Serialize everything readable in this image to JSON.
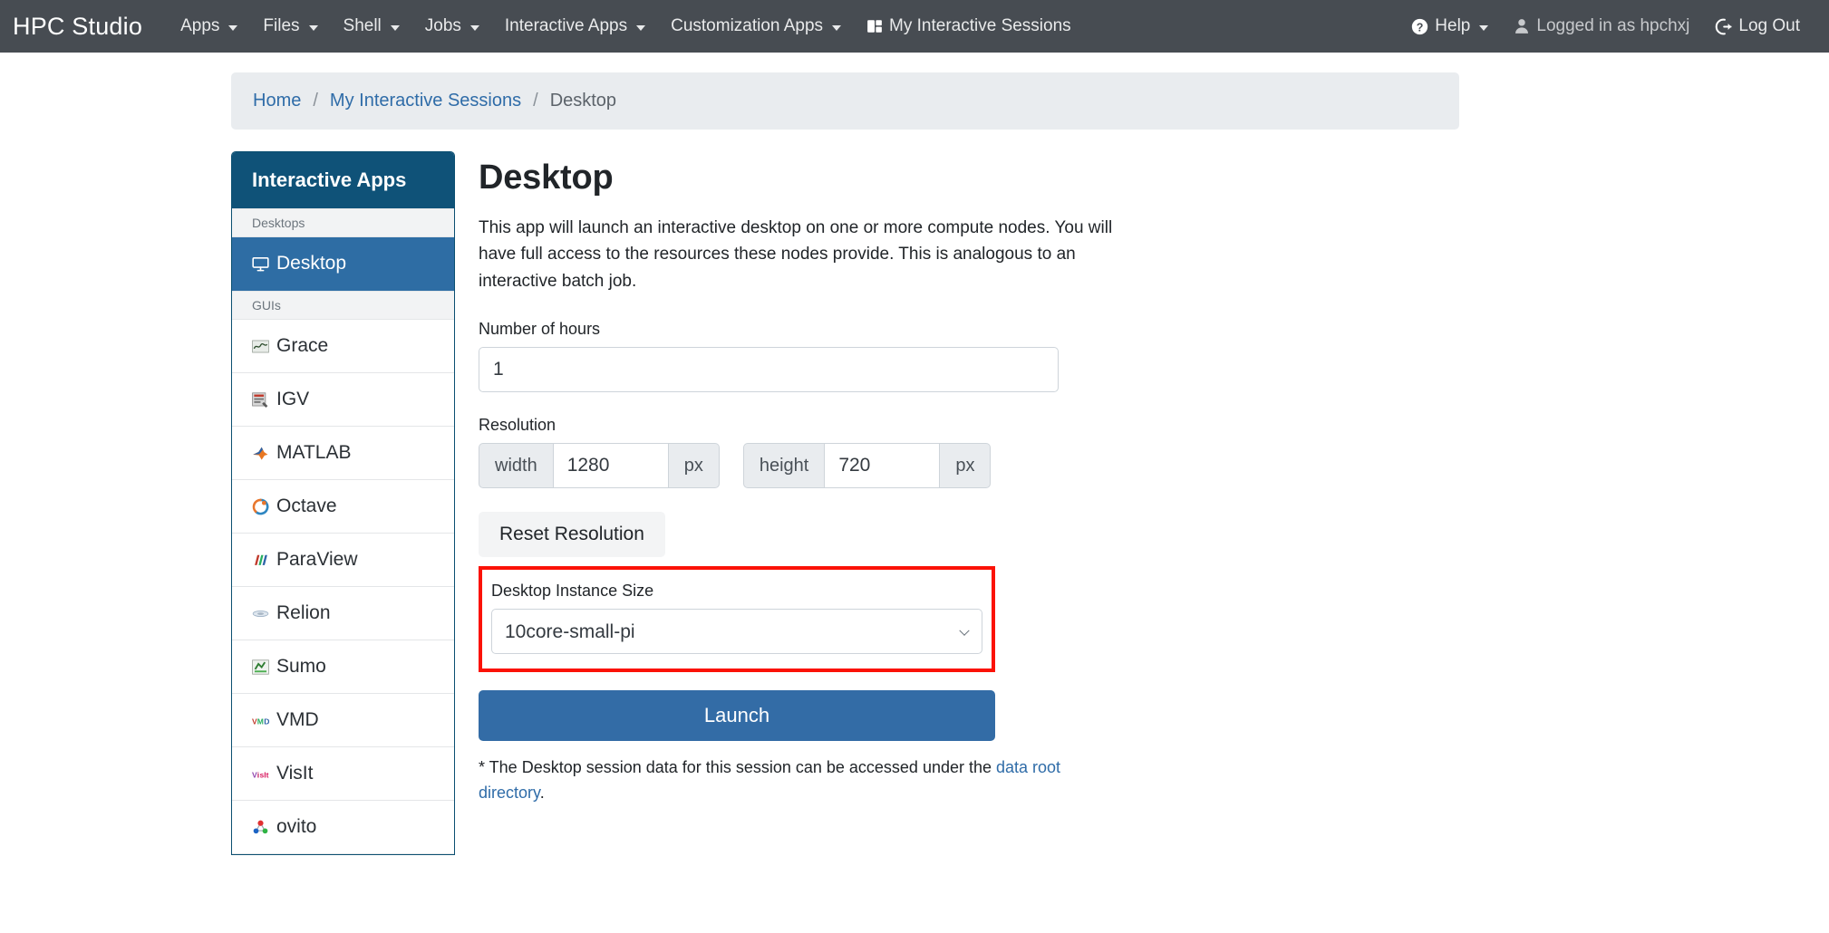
{
  "navbar": {
    "brand": "HPC Studio",
    "items": [
      {
        "label": "Apps",
        "caret": true,
        "icon": null
      },
      {
        "label": "Files",
        "caret": true,
        "icon": null
      },
      {
        "label": "Shell",
        "caret": true,
        "icon": null
      },
      {
        "label": "Jobs",
        "caret": true,
        "icon": null
      },
      {
        "label": "Interactive Apps",
        "caret": true,
        "icon": null
      },
      {
        "label": "Customization Apps",
        "caret": true,
        "icon": null
      },
      {
        "label": "My Interactive Sessions",
        "caret": false,
        "icon": "windows-stack-icon"
      }
    ],
    "right": [
      {
        "label": "Help",
        "caret": true,
        "icon": "question-circle-icon"
      },
      {
        "label": "Logged in as hpchxj",
        "caret": false,
        "icon": "user-icon"
      },
      {
        "label": "Log Out",
        "caret": false,
        "icon": "logout-icon"
      }
    ]
  },
  "breadcrumb": {
    "home": "Home",
    "sessions": "My Interactive Sessions",
    "current": "Desktop",
    "separator": "/"
  },
  "sidebar": {
    "header": "Interactive Apps",
    "groups": [
      {
        "label": "Desktops",
        "items": [
          {
            "label": "Desktop",
            "icon": "monitor-icon",
            "active": true
          }
        ]
      },
      {
        "label": "GUIs",
        "items": [
          {
            "label": "Grace",
            "icon": "grace-icon",
            "active": false
          },
          {
            "label": "IGV",
            "icon": "igv-icon",
            "active": false
          },
          {
            "label": "MATLAB",
            "icon": "matlab-icon",
            "active": false
          },
          {
            "label": "Octave",
            "icon": "octave-icon",
            "active": false
          },
          {
            "label": "ParaView",
            "icon": "paraview-icon",
            "active": false
          },
          {
            "label": "Relion",
            "icon": "relion-icon",
            "active": false
          },
          {
            "label": "Sumo",
            "icon": "sumo-icon",
            "active": false
          },
          {
            "label": "VMD",
            "icon": "vmd-icon",
            "active": false
          },
          {
            "label": "VisIt",
            "icon": "visit-icon",
            "active": false
          },
          {
            "label": "ovito",
            "icon": "ovito-icon",
            "active": false
          }
        ]
      }
    ]
  },
  "main": {
    "title": "Desktop",
    "description": "This app will launch an interactive desktop on one or more compute nodes. You will have full access to the resources these nodes provide. This is analogous to an interactive batch job.",
    "hours": {
      "label": "Number of hours",
      "value": "1"
    },
    "resolution": {
      "label": "Resolution",
      "width": {
        "addon": "width",
        "value": "1280",
        "unit": "px"
      },
      "height": {
        "addon": "height",
        "value": "720",
        "unit": "px"
      }
    },
    "reset_button": "Reset Resolution",
    "instance_size": {
      "label": "Desktop Instance Size",
      "selected": "10core-small-pi",
      "options": [
        "10core-small-pi"
      ],
      "highlight_color": "#fb1207"
    },
    "launch_button": "Launch",
    "footnote": {
      "prefix": "* The Desktop session data for this session can be accessed under the ",
      "link": "data root directory",
      "suffix": "."
    }
  },
  "colors": {
    "navbar_bg": "#474c52",
    "sidebar_header": "#0f5278",
    "sidebar_active": "#2e6da4",
    "primary": "#336ca6",
    "link": "#2f6ca8",
    "highlight": "#fb1207"
  }
}
